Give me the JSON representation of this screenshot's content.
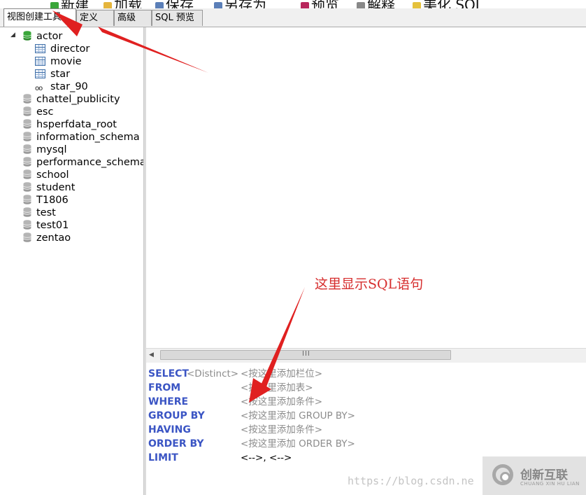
{
  "toolbar": {
    "items": [
      "新建",
      "加载",
      "保存",
      "另存为",
      "预览",
      "解释",
      "美化 SQL"
    ]
  },
  "tabs": [
    "视图创建工具",
    "定义",
    "高级",
    "SQL 预览"
  ],
  "tree": {
    "root": "actor",
    "children": [
      "director",
      "movie",
      "star",
      "star_90"
    ],
    "databases": [
      "chattel_publicity",
      "esc",
      "hsperfdata_root",
      "information_schema",
      "mysql",
      "performance_schema",
      "school",
      "student",
      "T1806",
      "test",
      "test01",
      "zentao"
    ]
  },
  "scrollbar": {
    "grip": "III"
  },
  "sql": {
    "select": {
      "keyword": "SELECT",
      "distinct": "<Distinct>",
      "hint": "<按这里添加栏位>"
    },
    "from": {
      "keyword": "FROM",
      "hint": "<按这里添加表>"
    },
    "where": {
      "keyword": "WHERE",
      "hint": "<按这里添加条件>"
    },
    "group_by": {
      "keyword": "GROUP BY",
      "hint": "<按这里添加 GROUP BY>"
    },
    "having": {
      "keyword": "HAVING",
      "hint": "<按这里添加条件>"
    },
    "order_by": {
      "keyword": "ORDER BY",
      "hint": "<按这里添加 ORDER BY>"
    },
    "limit": {
      "keyword": "LIMIT",
      "hint": "<-->, <-->"
    }
  },
  "annotation": "这里显示SQL语句",
  "watermark": "https://blog.csdn.ne",
  "logo": {
    "text": "创新互联",
    "sub": "CHUANG XIN HU LIAN"
  },
  "colors": {
    "keyword": "#3b55c4",
    "hint": "#8c8c8c",
    "annotation": "#d62d2d",
    "db_icon": "#3aa63a"
  }
}
